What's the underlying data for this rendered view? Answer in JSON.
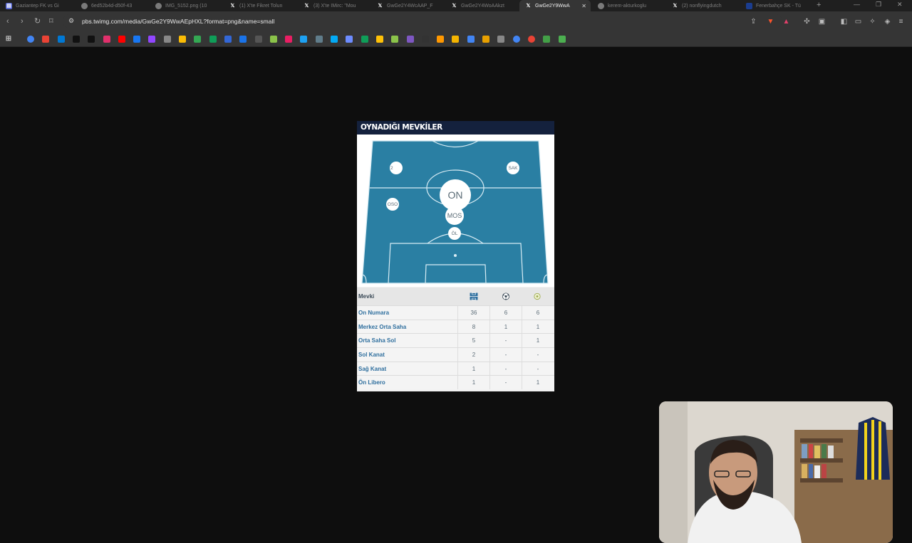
{
  "browser": {
    "tabs": [
      {
        "label": "Gaziantep FK vs Gi",
        "active": false,
        "icon": "doc-icon",
        "color": "#5b6bd6"
      },
      {
        "label": "6ed52b4d-d50f-43",
        "active": false,
        "icon": "globe-icon",
        "color": "#7a7a7a"
      },
      {
        "label": "IMG_5152.png (10",
        "active": false,
        "icon": "globe-icon",
        "color": "#7a7a7a"
      },
      {
        "label": "(1) X'te Fikret Tolun",
        "active": false,
        "icon": "x-icon",
        "color": "#111111"
      },
      {
        "label": "(3) X'te IMirc: \"Mou",
        "active": false,
        "icon": "x-icon",
        "color": "#111111"
      },
      {
        "label": "GwGe2Y4WcAAP_F",
        "active": false,
        "icon": "x-icon",
        "color": "#111111"
      },
      {
        "label": "GwGe2Y4WoAAkzt",
        "active": false,
        "icon": "x-icon",
        "color": "#111111"
      },
      {
        "label": "GwGe2Y9WwA",
        "active": true,
        "icon": "x-icon",
        "color": "#111111"
      },
      {
        "label": "kerem-akturkoglu",
        "active": false,
        "icon": "globe-icon",
        "color": "#7a7a7a"
      },
      {
        "label": "(2) nonflyingdutch",
        "active": false,
        "icon": "x-icon",
        "color": "#111111"
      },
      {
        "label": "Fenerbahçe SK - Tü",
        "active": false,
        "icon": "flag-icon",
        "color": "#1b3d8f"
      }
    ],
    "url": "pbs.twimg.com/media/GwGe2Y9WwAEpHXL?format=png&name=small",
    "bookmark_colors": [
      "#4285f4",
      "#ea4335",
      "#0078d4",
      "#111111",
      "#111111",
      "#e1306c",
      "#ff0000",
      "#1877f2",
      "#9146ff",
      "#888888",
      "#fbbc05",
      "#34a853",
      "#0f9d58",
      "#3367d6",
      "#1a73e8",
      "#555555",
      "#8bc34a",
      "#e91e63",
      "#1da1f2",
      "#607d8b",
      "#03a9f4",
      "#6d8cff",
      "#0f9d58",
      "#ffc107",
      "#8bc34a",
      "#7e57c2",
      "#333333",
      "#ff9800",
      "#f4b400",
      "#4285f4",
      "#e8a000",
      "#888888",
      "#4285f4",
      "#ea4335",
      "#43a047",
      "#4caf50"
    ]
  },
  "card": {
    "title": "OYNADIĞI MEVKİLER",
    "positions": [
      {
        "label": "ON",
        "size": "large"
      },
      {
        "label": "MOS",
        "size": "medium"
      },
      {
        "label": "OSO",
        "size": "small"
      },
      {
        "label": "ÖL",
        "size": "small"
      },
      {
        "label": "SAK",
        "size": "small"
      },
      {
        "label": "2",
        "size": "small"
      }
    ],
    "table": {
      "header": "Mevki",
      "columns": [
        {
          "icon": "pitch-icon"
        },
        {
          "icon": "ball-icon"
        },
        {
          "icon": "assist-icon"
        }
      ],
      "rows": [
        {
          "name": "On Numara",
          "apps": "36",
          "goals": "6",
          "assists": "6"
        },
        {
          "name": "Merkez Orta Saha",
          "apps": "8",
          "goals": "1",
          "assists": "1"
        },
        {
          "name": "Orta Saha Sol",
          "apps": "5",
          "goals": "-",
          "assists": "1"
        },
        {
          "name": "Sol Kanat",
          "apps": "2",
          "goals": "-",
          "assists": "-"
        },
        {
          "name": "Sağ Kanat",
          "apps": "1",
          "goals": "-",
          "assists": "-"
        },
        {
          "name": "Ön Libero",
          "apps": "1",
          "goals": "-",
          "assists": "1"
        }
      ]
    },
    "colors": {
      "title_bg": "#14213d",
      "pitch": "#2a7fa3",
      "row_name": "#2f6f9e"
    }
  }
}
